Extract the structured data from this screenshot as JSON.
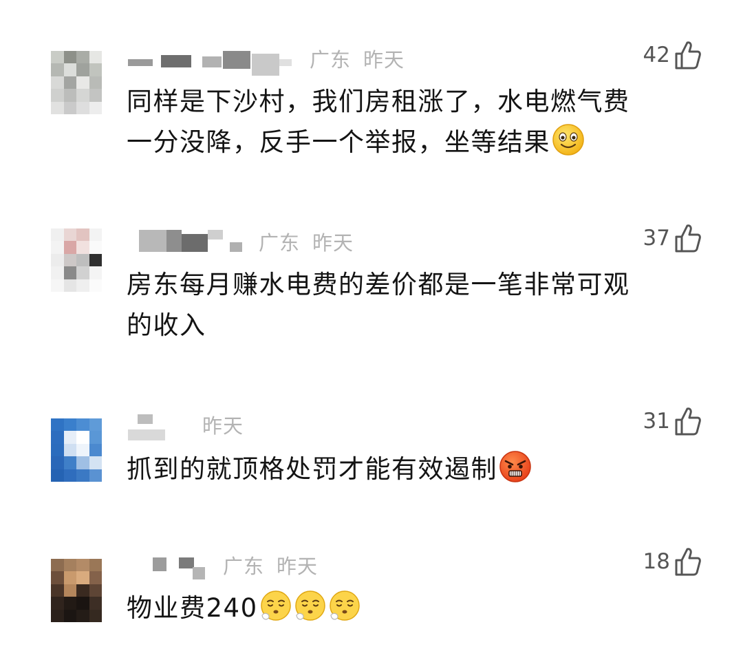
{
  "comments": [
    {
      "location": "广东",
      "time": "昨天",
      "likes": "42",
      "text_lines": [
        "同样是下沙村，我们房租涨了，水电燃气费",
        "一分没降，反手一个举报，坐等结果"
      ],
      "emojis": [
        "smile-emoji"
      ]
    },
    {
      "location": "广东",
      "time": "昨天",
      "likes": "37",
      "text_lines": [
        "房东每月赚水电费的差价都是一笔非常可观",
        "的收入"
      ],
      "emojis": []
    },
    {
      "location": "",
      "time": "昨天",
      "likes": "31",
      "text_lines": [
        "抓到的就顶格处罚才能有效遏制"
      ],
      "emojis": [
        "angry-emoji"
      ]
    },
    {
      "location": "广东",
      "time": "昨天",
      "likes": "18",
      "text_lines": [
        "物业费240"
      ],
      "emojis": [
        "sigh-emoji",
        "sigh-emoji",
        "sigh-emoji"
      ]
    }
  ]
}
